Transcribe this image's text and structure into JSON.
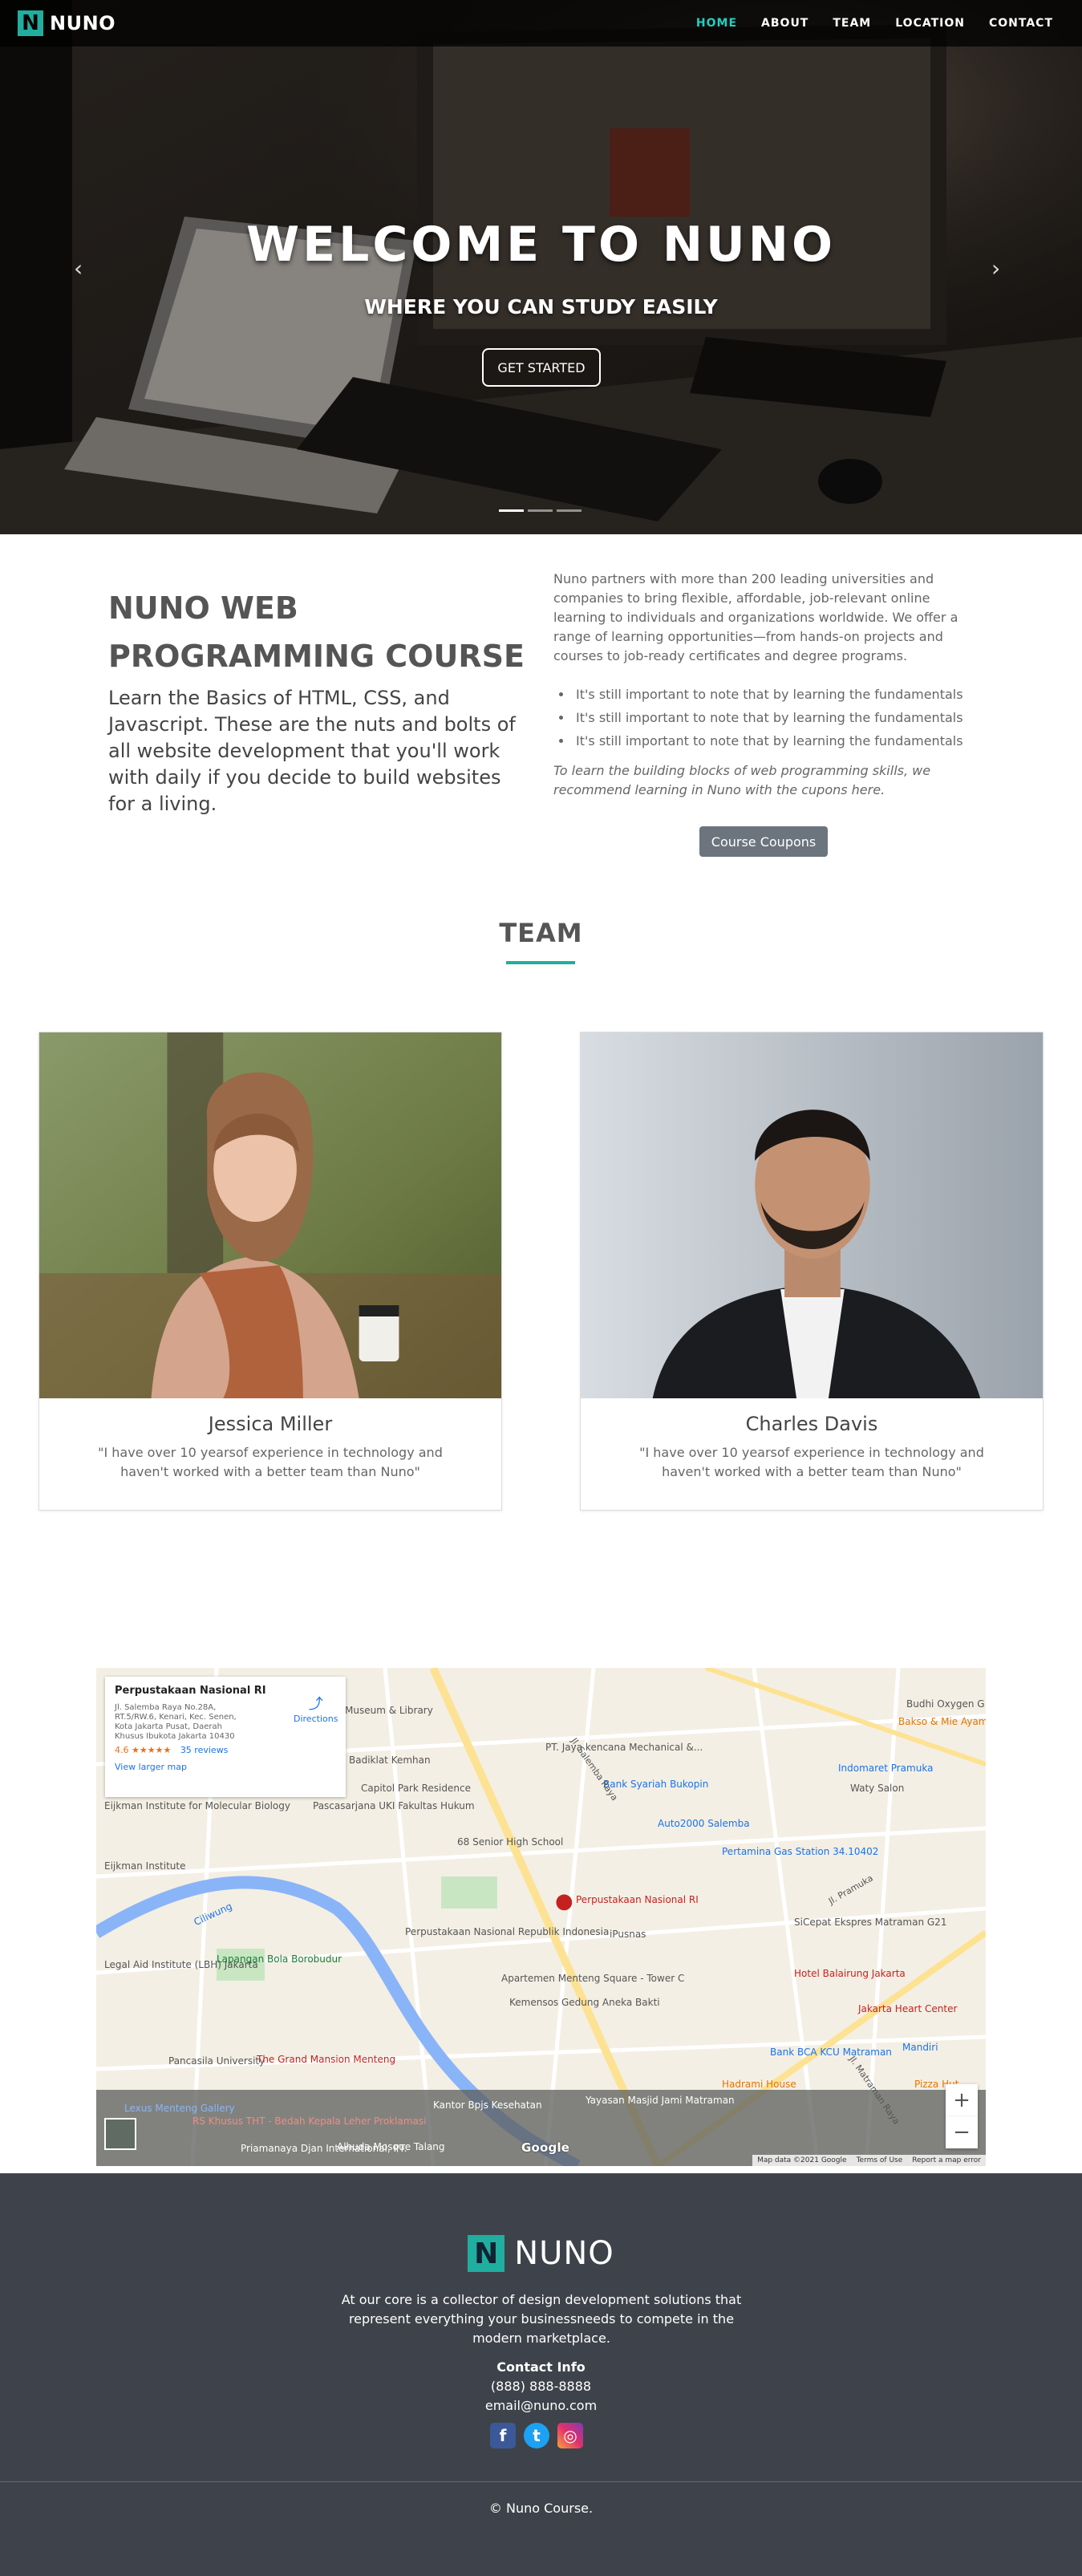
{
  "brand": {
    "logo_letter": "N",
    "name": "NUNO"
  },
  "nav": {
    "items": [
      {
        "label": "HOME",
        "active": true
      },
      {
        "label": "ABOUT"
      },
      {
        "label": "TEAM"
      },
      {
        "label": "LOCATION"
      },
      {
        "label": "CONTACT"
      }
    ]
  },
  "hero": {
    "title": "WELCOME TO NUNO",
    "subtitle": "WHERE YOU CAN STUDY EASILY",
    "cta": "GET STARTED",
    "prev_icon": "chevron-left-icon",
    "next_icon": "chevron-right-icon",
    "slide_count": 3,
    "active_slide": 1
  },
  "about": {
    "heading": "NUNO WEB PROGRAMMING COURSE",
    "lead": "Learn the Basics of HTML, CSS, and Javascript. These are the nuts and bolts of all website development that you'll work with daily if you decide to build websites for a living.",
    "paragraph": "Nuno partners with more than 200 leading universities and companies to bring flexible, affordable, job-relevant online learning to individuals and organizations worldwide. We offer a range of learning opportunities—from hands-on projects and courses to job-ready certificates and degree programs.",
    "bullets": [
      "It's still important to note that by learning the fundamentals",
      "It's still important to note that by learning the fundamentals",
      "It's still important to note that by learning the fundamentals"
    ],
    "italic": "To learn the building blocks of web programming skills, we recommend learning in Nuno with the cupons here.",
    "button": "Course Coupons"
  },
  "team": {
    "title": "TEAM",
    "members": [
      {
        "name": "Jessica Miller",
        "quote": "\"I have over 10 yearsof experience in technology and haven't worked with a better team than Nuno\""
      },
      {
        "name": "Charles Davis",
        "quote": "\"I have over 10 yearsof experience in technology and haven't worked with a better team than Nuno\""
      }
    ]
  },
  "map": {
    "place_name": "Perpustakaan Nasional RI",
    "address": "Jl. Salemba Raya No.28A, RT.5/RW.6, Kenari, Kec. Senen, Kota Jakarta Pusat, Daerah Khusus Ibukota Jakarta 10430",
    "rating": "4.6",
    "stars": "★★★★★",
    "reviews": "35 reviews",
    "larger_map": "View larger map",
    "directions": "Directions",
    "zoom_in": "+",
    "zoom_out": "−",
    "logo": "Google",
    "attribution": [
      "Map data ©2021 Google",
      "Terms of Use",
      "Report a map error"
    ],
    "labels": {
      "museum": "Museum & Library",
      "badiklat": "Badiklat Kemhan",
      "capitol": "Capitol Park Residence",
      "pasca": "Pascasarjana UKI Fakultas Hukum",
      "eijkman_inst": "Eijkman Institute for Molecular Biology",
      "eijkman": "Eijkman Institute",
      "senior": "68 Senior High School",
      "pt_jaya": "PT. Jaya kencana Mechanical &...",
      "bukopin": "Bank Syariah Bukopin",
      "auto2000": "Auto2000 Salemba",
      "pertamina": "Pertamina Gas Station 34.10402",
      "main_pin": "Perpustakaan Nasional RI",
      "perpus": "Perpustakaan Nasional Republik Indonesia",
      "ipusnas": "iPusnas",
      "apartemen": "Apartemen Menteng Square - Tower C",
      "kemensos": "Kemensos Gedung Aneka Bakti",
      "lbh": "Legal Aid Institute (LBH) Jakarta",
      "borobudur": "Lapangan Bola Borobudur",
      "pancasila": "Pancasila University",
      "grand": "The Grand Mansion Menteng",
      "ciliwung": "Ciliwung",
      "indomaret": "Indomaret Pramuka",
      "watysalon": "Waty Salon",
      "sicepat": "SiCepat Ekspres Matraman G21",
      "balairung": "Hotel Balairung Jakarta",
      "heart": "Jakarta Heart Center",
      "bca": "Bank BCA KCU Matraman",
      "mandiri": "Mandiri",
      "hadrami": "Hadrami House",
      "pizza": "Pizza Hut",
      "yayasan": "Yayasan Masjid Jami Matraman",
      "kantor": "Kantor Bpjs Kesehatan",
      "lexus": "Lexus Menteng Gallery",
      "rskhusus": "RS Khusus THT - Bedah Kepala Leher Proklamasi",
      "priamanaya": "Priamanaya Djan International, PT.",
      "alhuda": "Alhuda Mosque Talang",
      "bakso": "Bakso & Mie Ayam Pakde Roso",
      "budhi": "Budhi Oxygen G",
      "st_salemba": "Jl. Salemba Raya",
      "st_pramuka": "Jl. Pramuka",
      "st_matraman": "Jl. Matraman Raya"
    }
  },
  "footer": {
    "logo_letter": "N",
    "name": "NUNO",
    "description": "At our core is a collector of design development solutions that represent everything your businessneeds to compete in the modern marketplace.",
    "contact_title": "Contact Info",
    "phone": "(888) 888-8888",
    "email": "email@nuno.com",
    "socials": [
      "facebook-icon",
      "twitter-icon",
      "instagram-icon"
    ],
    "copyright": "© Nuno Course."
  }
}
